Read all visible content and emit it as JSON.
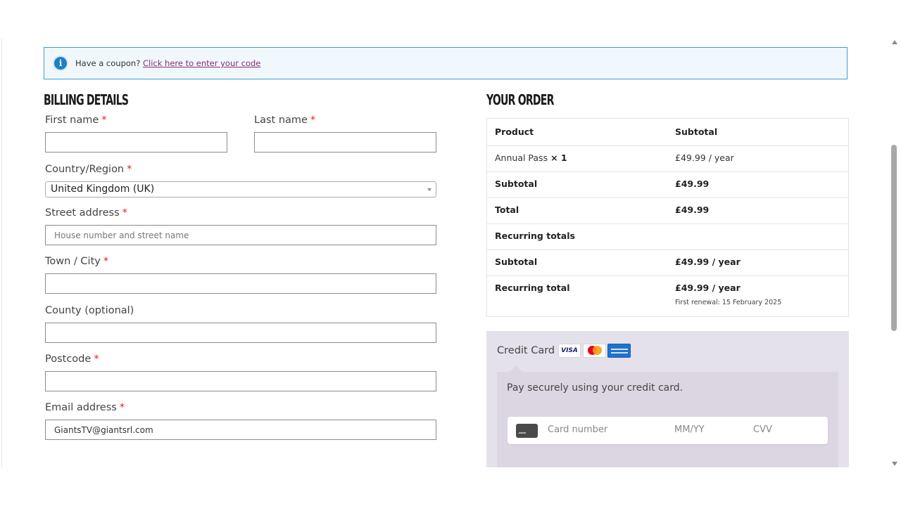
{
  "coupon": {
    "prompt": "Have a coupon?",
    "link": "Click here to enter your code"
  },
  "billing": {
    "heading": "BILLING DETAILS",
    "required_marker": "*",
    "first_name_label": "First name",
    "last_name_label": "Last name",
    "country_label": "Country/Region",
    "country_value": "United Kingdom (UK)",
    "street_label": "Street address",
    "street_placeholder": "House number and street name",
    "town_label": "Town / City",
    "county_label": "County (optional)",
    "postcode_label": "Postcode",
    "email_label": "Email address",
    "email_value": "GiantsTV@giantsrl.com"
  },
  "order": {
    "heading": "YOUR ORDER",
    "col_product": "Product",
    "col_subtotal": "Subtotal",
    "item_name": "Annual Pass",
    "item_qty": "× 1",
    "item_price": "£49.99 / year",
    "subtotal_label": "Subtotal",
    "subtotal_value": "£49.99",
    "total_label": "Total",
    "total_value": "£49.99",
    "recurring_heading": "Recurring totals",
    "recurring_subtotal_label": "Subtotal",
    "recurring_subtotal_value": "£49.99 / year",
    "recurring_total_label": "Recurring total",
    "recurring_total_value": "£49.99 / year",
    "first_renewal": "First renewal: 15 February 2025"
  },
  "payment": {
    "method": "Credit Card",
    "visa_label": "VISA",
    "description": "Pay securely using your credit card.",
    "card_number_placeholder": "Card number",
    "expiry_placeholder": "MM/YY",
    "cvv_placeholder": "CVV"
  },
  "colors": {
    "required": "#e2231a",
    "coupon_link": "#8a2a78",
    "info_icon": "#1e7fc2",
    "payment_bg": "#e5e1ea"
  }
}
